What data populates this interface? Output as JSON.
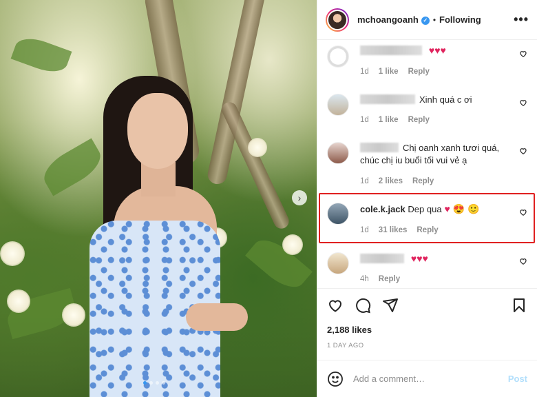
{
  "post": {
    "slide_count": 4,
    "active_slide": 1
  },
  "header": {
    "username": "mchoangoanh",
    "separator": "•",
    "follow_status": "Following",
    "more_label": "•••"
  },
  "comments": [
    {
      "username_hidden": true,
      "text": "",
      "emoji": "♥♥♥",
      "age": "1d",
      "likes": "1 like",
      "reply": "Reply",
      "avatar": "logo"
    },
    {
      "username_hidden": true,
      "text": "Xinh quá c ơi",
      "emoji": "",
      "age": "1d",
      "likes": "1 like",
      "reply": "Reply",
      "avatar": "photo"
    },
    {
      "username_hidden": true,
      "text": "Chị oanh xanh tươi quá, chúc chị iu buổi tối vui vẻ ạ",
      "emoji": "",
      "age": "1d",
      "likes": "2 likes",
      "reply": "Reply",
      "avatar": "photo"
    },
    {
      "username": "cole.k.jack",
      "text": "Dep qua",
      "emoji": "♥ 😍 🙂",
      "age": "1d",
      "likes": "31 likes",
      "reply": "Reply",
      "avatar": "photo",
      "highlighted": true
    },
    {
      "username_hidden": true,
      "text": "",
      "emoji": "♥♥♥",
      "age": "4h",
      "likes": "",
      "reply": "Reply",
      "avatar": "photo"
    }
  ],
  "footer": {
    "likes": "2,188 likes",
    "posted": "1 DAY AGO",
    "comment_placeholder": "Add a comment…",
    "post_label": "Post"
  },
  "colors": {
    "verified": "#3897f0",
    "highlight_border": "#e02020",
    "heart": "#e0245e",
    "post_disabled": "#b2dffc"
  },
  "icons": [
    "verified-icon",
    "heart-icon",
    "comment-icon",
    "share-icon",
    "bookmark-icon",
    "smile-icon",
    "chevron-right-icon"
  ]
}
